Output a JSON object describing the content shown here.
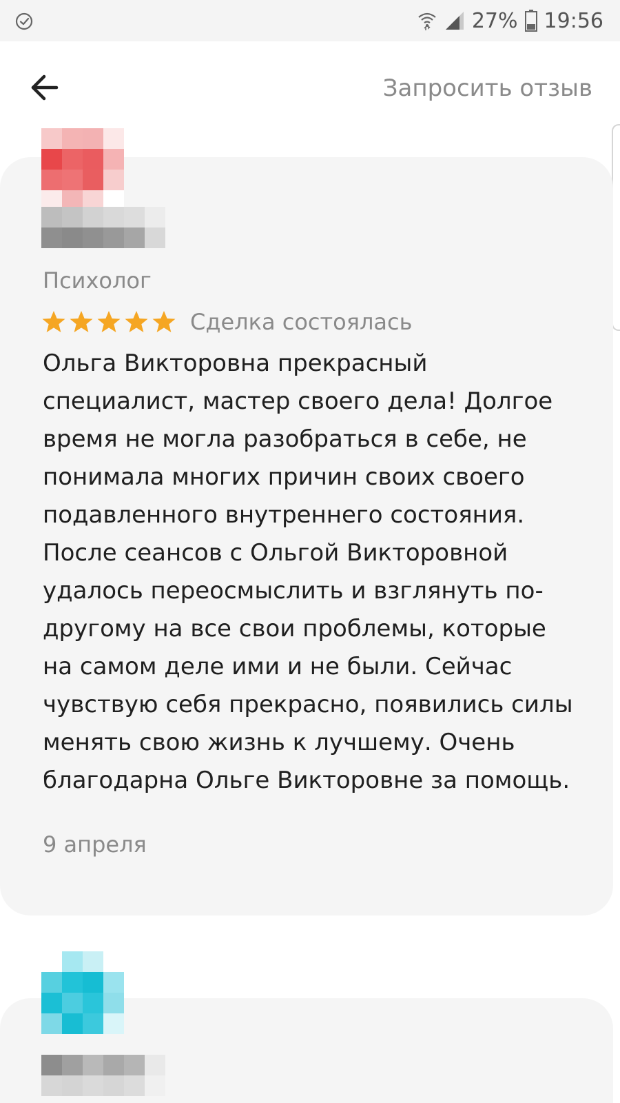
{
  "status_bar": {
    "battery": "27%",
    "time": "19:56",
    "icons": [
      "check-circle-icon",
      "wifi-icon",
      "signal-icon",
      "battery-icon"
    ]
  },
  "header": {
    "back_icon": "arrow-left-icon",
    "action_label": "Запросить отзыв"
  },
  "reviews": [
    {
      "category": "Психолог",
      "rating": 5,
      "rating_max": 5,
      "deal_status": "Сделка состоялась",
      "text": "Ольга Викторовна прекрасный специалист, мастер своего дела! Долгое время не могла разобраться в себе, не понимала многих причин своих своего подавленного внутреннего состояния. После сеансов с Ольгой Викторовной удалось переосмыслить и взглянуть по-другому на все свои проблемы, которые на самом деле ими и не были. Сейчас чувствую себя прекрасно, появились силы менять свою жизнь к лучшему. Очень благодарна Ольге Викторовне за помощь.",
      "date": "9 апреля",
      "avatar_color": "#e8474a"
    },
    {
      "avatar_color": "#1cbfd6"
    }
  ],
  "colors": {
    "star": "#f5a623",
    "card_bg": "#f5f5f5",
    "secondary_text": "#8a8a8a",
    "primary_text": "#1f1f1f"
  }
}
